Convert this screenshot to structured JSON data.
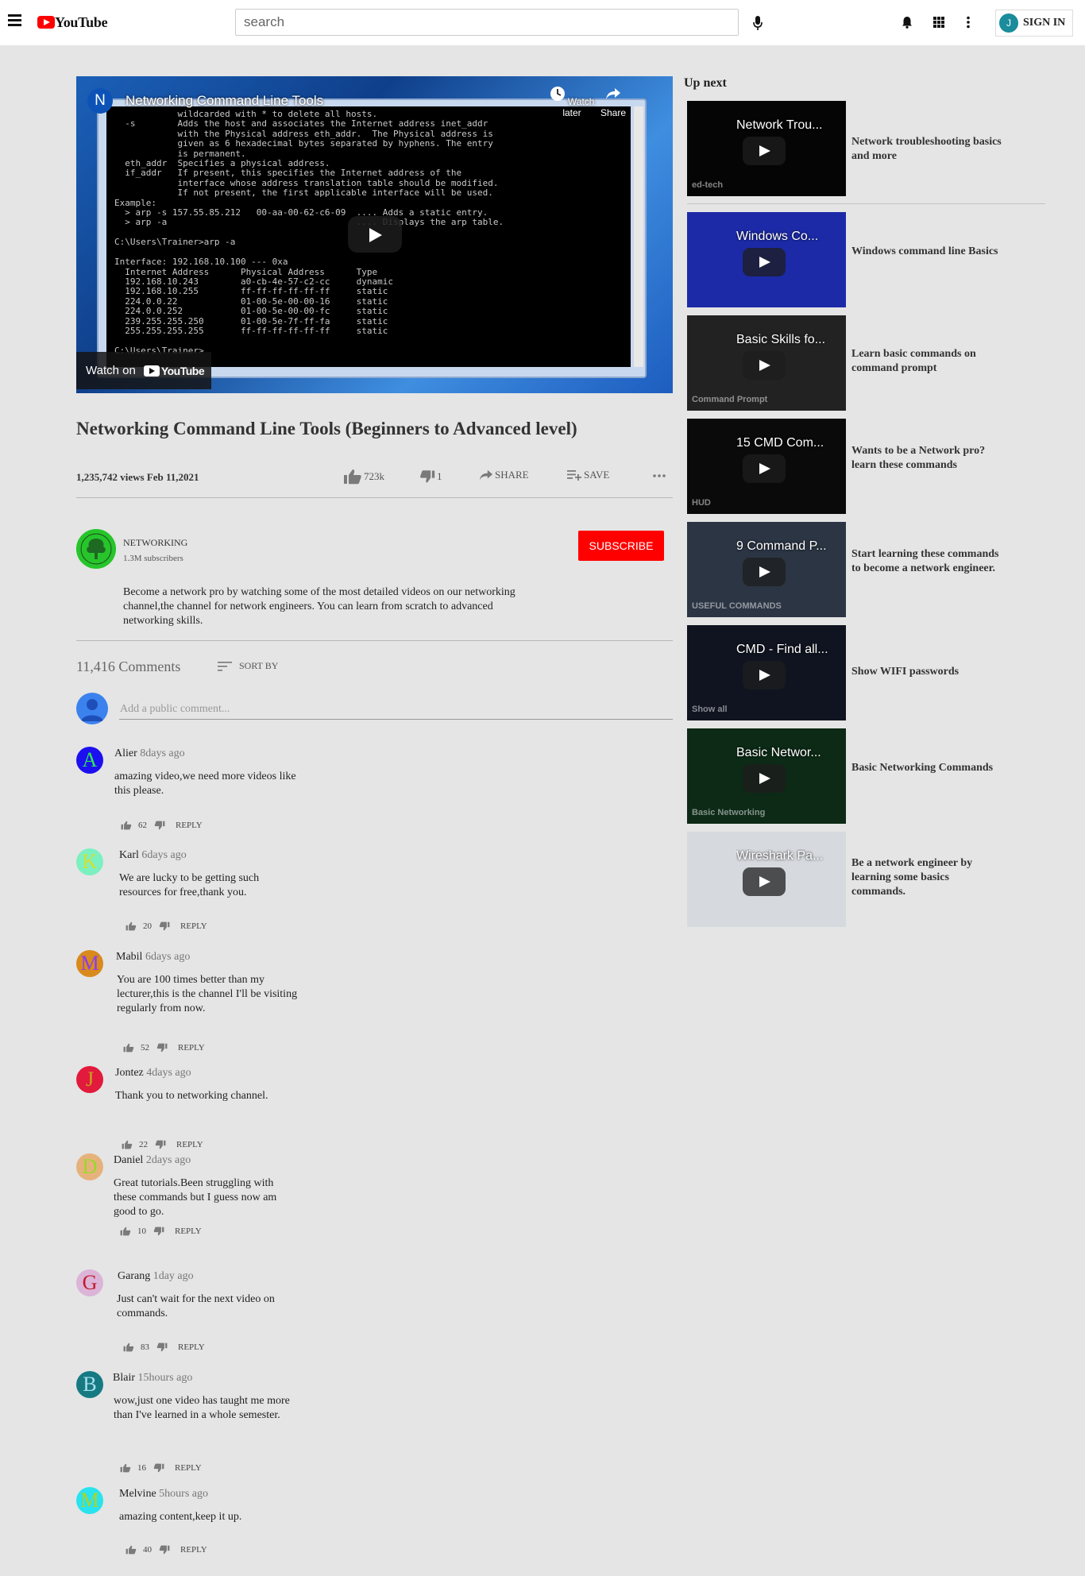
{
  "header": {
    "logo_text": "YouTube",
    "search_placeholder": "search",
    "signin_avatar": "J",
    "signin_label": "SIGN IN"
  },
  "player": {
    "channel_letter": "N",
    "title": "Networking Command Line Tools",
    "watch_later": "Watch later",
    "share": "Share",
    "watch_on": "Watch on",
    "watch_on_brand": "YouTube",
    "terminal_text": "            wildcarded with * to delete all hosts.\n  -s        Adds the host and associates the Internet address inet_addr\n            with the Physical address eth_addr.  The Physical address is\n            given as 6 hexadecimal bytes separated by hyphens. The entry\n            is permanent.\n  eth_addr  Specifies a physical address.\n  if_addr   If present, this specifies the Internet address of the\n            interface whose address translation table should be modified.\n            If not present, the first applicable interface will be used.\nExample:\n  > arp -s 157.55.85.212   00-aa-00-62-c6-09  .... Adds a static entry.\n  > arp -a                                    .... Displays the arp table.\n\nC:\\Users\\Trainer>arp -a\n\nInterface: 192.168.10.100 --- 0xa\n  Internet Address      Physical Address      Type\n  192.168.10.243        a0-cb-4e-57-c2-cc     dynamic\n  192.168.10.255        ff-ff-ff-ff-ff-ff     static\n  224.0.0.22            01-00-5e-00-00-16     static\n  224.0.0.252           01-00-5e-00-00-fc     static\n  239.255.255.250       01-00-5e-7f-ff-fa     static\n  255.255.255.255       ff-ff-ff-ff-ff-ff     static\n\nC:\\Users\\Trainer>"
  },
  "video": {
    "title": "Networking Command Line Tools (Beginners to Advanced level)",
    "stats": "1,235,742 views Feb 11,2021",
    "likes": "723k",
    "dislikes": "1",
    "share_label": "SHARE",
    "save_label": "SAVE"
  },
  "channel": {
    "name": "NETWORKING",
    "subscribers": "1.3M subscribers",
    "subscribe_label": "SUBSCRIBE",
    "description": "Become a network pro by watching some of the most detailed videos on our networking channel,the channel for network engineers. You can learn from scratch to advanced networking skills."
  },
  "comments_section": {
    "count": "11,416 Comments",
    "sort_label": "SORT BY",
    "input_placeholder": "Add a public comment...",
    "reply_label": "REPLY"
  },
  "comments": [
    {
      "avatar": "A",
      "avatar_bg": "#1d10f0",
      "avatar_fg": "#2ee85a",
      "author": "Alier",
      "time": "8days ago",
      "text": "amazing video,we need more videos like this please.",
      "likes": "62"
    },
    {
      "avatar": "K",
      "avatar_bg": "#7df0c0",
      "avatar_fg": "#d6e02a",
      "author": "Karl",
      "time": "6days ago",
      "text": "We are lucky to be getting such resources for free,thank you.",
      "likes": "20"
    },
    {
      "avatar": "M",
      "avatar_bg": "#d88a1c",
      "avatar_fg": "#8a3cf0",
      "author": "Mabil",
      "time": "6days ago",
      "text": "You are 100 times better than my lecturer,this is the channel I'll be visiting regularly from now.",
      "likes": "52"
    },
    {
      "avatar": "J",
      "avatar_bg": "#e21a3c",
      "avatar_fg": "#c7a41b",
      "author": "Jontez",
      "time": "4days ago",
      "text": "Thank you to networking channel.",
      "likes": "22"
    },
    {
      "avatar": "D",
      "avatar_bg": "#e6b27c",
      "avatar_fg": "#9bd82a",
      "author": "Daniel",
      "time": "2days ago",
      "text": "Great tutorials.Been struggling with these commands but I guess now am good to go.",
      "likes": "10"
    },
    {
      "avatar": "G",
      "avatar_bg": "#dbb4d8",
      "avatar_fg": "#c21a2a",
      "author": "Garang",
      "time": "1day ago",
      "text": "Just can't wait for the next video on commands.",
      "likes": "83"
    },
    {
      "avatar": "B",
      "avatar_bg": "#177a83",
      "avatar_fg": "#a8e0f0",
      "author": "Blair",
      "time": "15hours ago",
      "text": "wow,just one video has taught me more than I've learned in a whole semester.",
      "likes": "16"
    },
    {
      "avatar": "M",
      "avatar_bg": "#29e3ee",
      "avatar_fg": "#b3d21c",
      "author": "Melvine",
      "time": "5hours ago",
      "text": "amazing content,keep it up.",
      "likes": "40"
    }
  ],
  "sidebar": {
    "heading": "Up next",
    "items": [
      {
        "thumb_title": "Network Trou...",
        "title": "Network troubleshooting basics and more",
        "thumb_bg": "#050505",
        "badge": "ed-tech"
      },
      {
        "thumb_title": "Windows Co...",
        "title": "Windows command line Basics",
        "thumb_bg": "#1c2aa8",
        "badge": ""
      },
      {
        "thumb_title": "Basic Skills fo...",
        "title": "Learn basic commands on command prompt",
        "thumb_bg": "#222222",
        "badge": "Command Prompt"
      },
      {
        "thumb_title": "15 CMD Com...",
        "title": "Wants to be a Network pro? learn these commands",
        "thumb_bg": "#0a0a0a",
        "badge": "HUD"
      },
      {
        "thumb_title": "9 Command P...",
        "title": "Start learning these commands to become a network engineer.",
        "thumb_bg": "#2b3544",
        "badge": "USEFUL COMMANDS"
      },
      {
        "thumb_title": "CMD - Find all...",
        "title": "Show WIFI passwords",
        "thumb_bg": "#0f1420",
        "badge": "Show all"
      },
      {
        "thumb_title": "Basic Networ...",
        "title": "Basic Networking Commands",
        "thumb_bg": "#0c2a16",
        "badge": "Basic Networking"
      },
      {
        "thumb_title": "Wireshark Pa...",
        "title": "Be a network engineer by learning some basics commands.",
        "thumb_bg": "#d6d9de",
        "badge": ""
      }
    ]
  }
}
